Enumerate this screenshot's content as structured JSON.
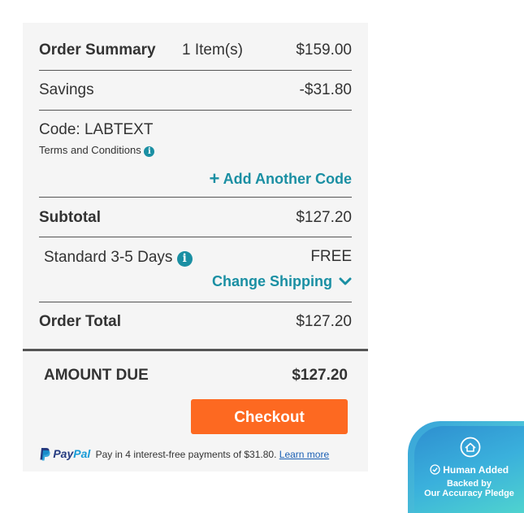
{
  "summary": {
    "title": "Order Summary",
    "items": "1 Item(s)",
    "items_total": "$159.00",
    "savings_label": "Savings",
    "savings_value": "-$31.80",
    "code_label": "Code: LABTEXT",
    "terms_label": "Terms and Conditions",
    "add_code_label": "Add Another Code",
    "subtotal_label": "Subtotal",
    "subtotal_value": "$127.20",
    "shipping_label": "Standard 3-5 Days",
    "shipping_value": "FREE",
    "change_shipping_label": "Change Shipping",
    "order_total_label": "Order Total",
    "order_total_value": "$127.20",
    "amount_due_label": "AMOUNT DUE",
    "amount_due_value": "$127.20",
    "checkout_label": "Checkout"
  },
  "paypal": {
    "logo_pay": "Pay",
    "logo_pal": "Pal",
    "message": "Pay in 4 interest-free payments of $31.80.",
    "learn_more": "Learn more"
  },
  "badge": {
    "title": "Human Added",
    "line1": "Backed by",
    "line2": "Our Accuracy Pledge"
  },
  "colors": {
    "accent": "#1a8fa3",
    "checkout": "#fd6921",
    "panel_bg": "#f5f5f5"
  },
  "icons": [
    "info-icon",
    "plus-icon",
    "chevron-down-icon",
    "paypal-icon",
    "home-icon",
    "check-circle-icon"
  ]
}
